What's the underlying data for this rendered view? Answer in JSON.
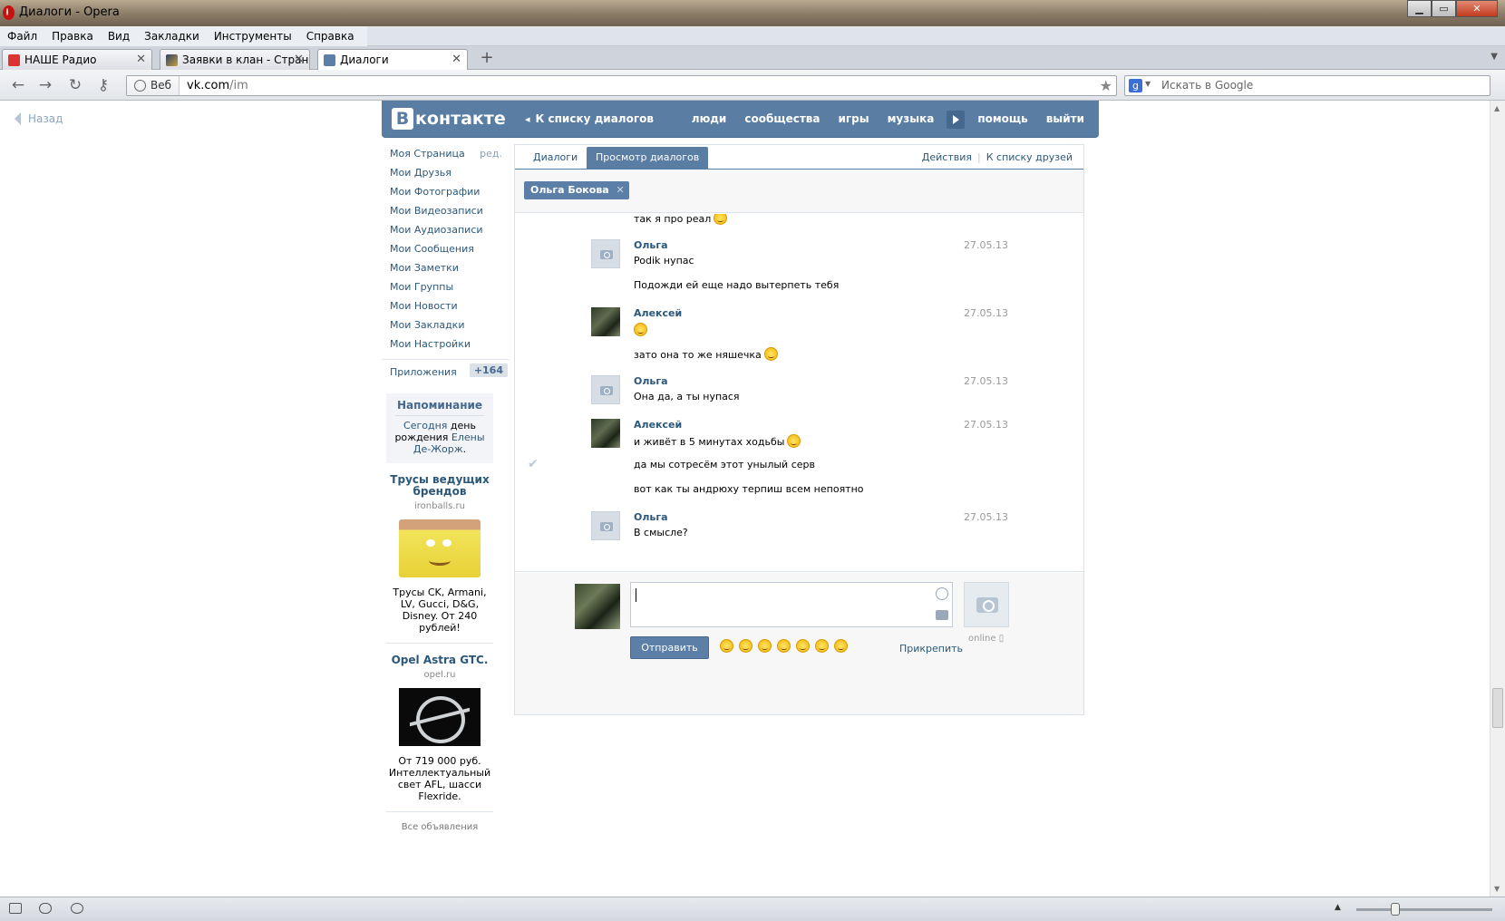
{
  "window": {
    "title": "Диалоги - Opera"
  },
  "menu": [
    "Файл",
    "Правка",
    "Вид",
    "Закладки",
    "Инструменты",
    "Справка"
  ],
  "tabs": [
    {
      "label": "НАШЕ Радио",
      "active": false
    },
    {
      "label": "Заявки в клан - Стран...",
      "active": false
    },
    {
      "label": "Диалоги",
      "active": true
    }
  ],
  "address": {
    "mode": "Веб",
    "host": "vk.com",
    "path": "/im"
  },
  "search": {
    "placeholder": "Искать в Google"
  },
  "page": {
    "back": "Назад",
    "logo": {
      "b": "В",
      "word": "контакте"
    },
    "to_dialogs": "К списку диалогов",
    "nav": [
      "люди",
      "сообщества",
      "игры",
      "музыка",
      "помощь",
      "выйти"
    ],
    "left_menu": [
      "Моя Страница",
      "Мои Друзья",
      "Мои Фотографии",
      "Мои Видеозаписи",
      "Мои Аудиозаписи",
      "Мои Сообщения",
      "Мои Заметки",
      "Мои Группы",
      "Мои Новости",
      "Мои Закладки",
      "Мои Настройки"
    ],
    "edit": "ред.",
    "apps": {
      "label": "Приложения",
      "count": "+164"
    },
    "reminder": {
      "title": "Напоминание",
      "today": "Сегодня",
      "text1": " день рождения ",
      "person": "Елены Де-Жорж",
      "end": "."
    },
    "ads": [
      {
        "title": "Трусы ведущих брендов",
        "domain": "ironballs.ru",
        "text": "Трусы CK, Armani, LV, Gucci, D&G, Disney. От 240 рублей!"
      },
      {
        "title": "Opel Astra GTC.",
        "domain": "opel.ru",
        "text": "От 719 000 руб. Интеллектуальный свет AFL, шасси Flexride."
      }
    ],
    "all_ads": "Все объявления",
    "dialog_tabs": {
      "dialogs": "Диалоги",
      "view": "Просмотр диалогов",
      "actions": "Действия",
      "sep": "|",
      "friends": "К списку друзей"
    },
    "peer": "Ольга Бокова",
    "messages": [
      {
        "kind": "cont",
        "lines": [
          "так я про реал"
        ],
        "smiles": [
          true
        ]
      },
      {
        "kind": "msg",
        "author": "Ольга",
        "date": "27.05.13",
        "avatar": "photo",
        "lines": [
          "Podik нупас",
          "Подожди ей еще надо вытерпеть тебя"
        ],
        "smiles": [
          false,
          false
        ]
      },
      {
        "kind": "msg",
        "author": "Алексей",
        "date": "27.05.13",
        "avatar": "user",
        "lines": [
          "",
          "зато она то же няшечка"
        ],
        "smiles": [
          true,
          true
        ]
      },
      {
        "kind": "msg",
        "author": "Ольга",
        "date": "27.05.13",
        "avatar": "photo",
        "lines": [
          "Она да, а ты нупася"
        ],
        "smiles": [
          false
        ]
      },
      {
        "kind": "msg",
        "author": "Алексей",
        "date": "27.05.13",
        "avatar": "user",
        "lines": [
          "и живёт в 5 минутах ходьбы",
          "да мы сотресём этот унылый серв",
          "вот как ты андрюху терпиш всем непоятно"
        ],
        "smiles": [
          true,
          false,
          false
        ]
      },
      {
        "kind": "msg",
        "author": "Ольга",
        "date": "27.05.13",
        "avatar": "photo",
        "lines": [
          "В смысле?"
        ],
        "smiles": [
          false
        ]
      }
    ],
    "compose": {
      "send": "Отправить",
      "attach": "Прикрепить",
      "online": "online"
    }
  }
}
